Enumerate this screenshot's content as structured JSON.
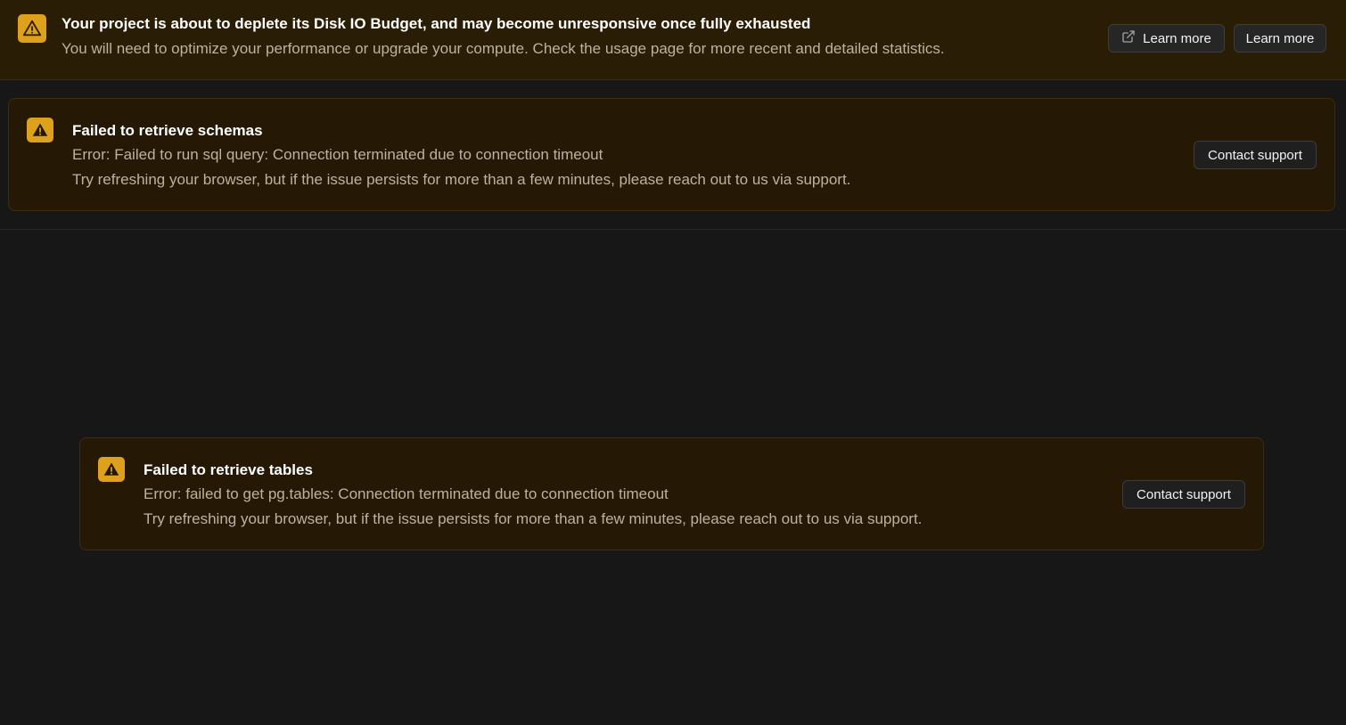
{
  "banner": {
    "icon": "warning-triangle-icon",
    "title": "Your project is about to deplete its Disk IO Budget, and may become unresponsive once fully exhausted",
    "description": "You will need to optimize your performance or upgrade your compute. Check the usage page for more recent and detailed statistics.",
    "buttons": [
      {
        "label": "Learn more",
        "icon": "external-link-icon"
      },
      {
        "label": "Learn more"
      }
    ]
  },
  "alerts": [
    {
      "icon": "warning-triangle-icon",
      "title": "Failed to retrieve schemas",
      "error": "Error: Failed to run sql query: Connection terminated due to connection timeout",
      "hint": "Try refreshing your browser, but if the issue persists for more than a few minutes, please reach out to us via support.",
      "button": "Contact support"
    },
    {
      "icon": "warning-triangle-icon",
      "title": "Failed to retrieve tables",
      "error": "Error: failed to get pg.tables: Connection terminated due to connection timeout",
      "hint": "Try refreshing your browser, but if the issue persists for more than a few minutes, please reach out to us via support.",
      "button": "Contact support"
    }
  ],
  "colors": {
    "warning_accent": "#dea11c",
    "banner_bg": "#2a1d06",
    "alert_bg": "#251906",
    "page_bg": "#171717"
  }
}
